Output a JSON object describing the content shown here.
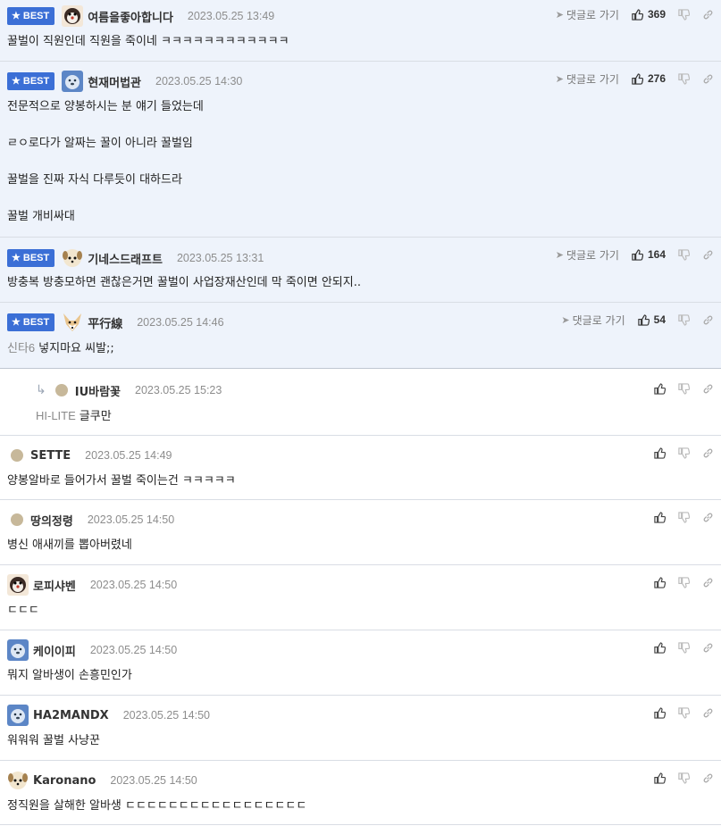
{
  "labels": {
    "best": "BEST",
    "goto": "댓글로 가기"
  },
  "colors": {
    "best_bg": "#eef3fb",
    "badge": "#3b6fd6"
  },
  "comments": [
    {
      "type": "best",
      "nick": "여름을좋아합니다",
      "date": "2023.05.25 13:49",
      "likes": "369",
      "avatar": "dog-dark-icon",
      "lines": [
        "꿀벌이 직원인데 직원을 죽이네 ㅋㅋㅋㅋㅋㅋㅋㅋㅋㅋㅋㅋ"
      ]
    },
    {
      "type": "best",
      "nick": "현재머법관",
      "date": "2023.05.25 14:30",
      "likes": "276",
      "avatar": "bear-blue-icon",
      "lines": [
        "전문적으로 양봉하시는 분 얘기 들었는데",
        "ㄹㅇ로다가 알짜는 꿀이 아니라 꿀벌임",
        "꿀벌을 진짜 자식 다루듯이 대하드라",
        "꿀벌 개비싸대"
      ]
    },
    {
      "type": "best",
      "nick": "기네스드래프트",
      "date": "2023.05.25 13:31",
      "likes": "164",
      "avatar": "puppy-icon",
      "lines": [
        "방충복 방충모하면 괜찮은거면 꿀벌이 사업장재산인데 막 죽이면 안되지.."
      ]
    },
    {
      "type": "best",
      "nick": "平行線",
      "date": "2023.05.25 14:46",
      "likes": "54",
      "avatar": "fox-icon",
      "prefix": "신타6",
      "lines": [
        "넣지마요 씨발;;"
      ]
    },
    {
      "type": "reply",
      "nick": "IU바람꽃",
      "date": "2023.05.25 15:23",
      "prefix": "HI-LITE",
      "lines": [
        "글쿠만"
      ]
    },
    {
      "type": "normal",
      "nick": "SETTE",
      "date": "2023.05.25 14:49",
      "avatar": "dot",
      "lines": [
        "양봉알바로 들어가서 꿀벌 죽이는건 ㅋㅋㅋㅋㅋ"
      ]
    },
    {
      "type": "normal",
      "nick": "땅의정령",
      "date": "2023.05.25 14:50",
      "avatar": "dot",
      "lines": [
        "병신 애새끼를 뽑아버렸네"
      ]
    },
    {
      "type": "normal",
      "nick": "로피샤벤",
      "date": "2023.05.25 14:50",
      "avatar": "dog-dark-icon",
      "lines": [
        "ㄷㄷㄷ"
      ]
    },
    {
      "type": "normal",
      "nick": "케이이피",
      "date": "2023.05.25 14:50",
      "avatar": "bear-blue-icon",
      "lines": [
        "뭐지 알바생이 손흥민인가"
      ]
    },
    {
      "type": "normal",
      "nick": "HA2MANDX",
      "date": "2023.05.25 14:50",
      "avatar": "bear-blue-icon",
      "lines": [
        "워워워 꿀벌 사냥꾼"
      ]
    },
    {
      "type": "normal",
      "nick": "Karonano",
      "date": "2023.05.25 14:50",
      "avatar": "puppy-icon",
      "lines": [
        "정직원을 살해한 알바생 ㄷㄷㄷㄷㄷㄷㄷㄷㄷㄷㄷㄷㄷㄷㄷㄷㄷ"
      ]
    }
  ]
}
